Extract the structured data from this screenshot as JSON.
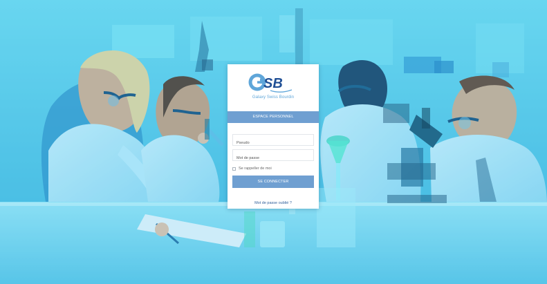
{
  "brand": {
    "logo_letters": "GSB",
    "name": "Galaxy Swiss Bourdin",
    "logo_primary_color": "#5fa6d9",
    "logo_secondary_color": "#1f4f95"
  },
  "login": {
    "section_title": "ESPACE PERSONNEL",
    "username_placeholder": "Pseudo",
    "password_placeholder": "Mot de passe",
    "remember_label": "Se rappeller de moi",
    "submit_label": "SE CONNECTER",
    "forgot_password_label": "Mot de passe oublié ?",
    "header_color": "#6f9fd1",
    "button_color": "#6f9fd1"
  },
  "icons": {
    "checkbox": "checkbox-icon"
  },
  "background": {
    "theme_color": "#42b3df"
  }
}
